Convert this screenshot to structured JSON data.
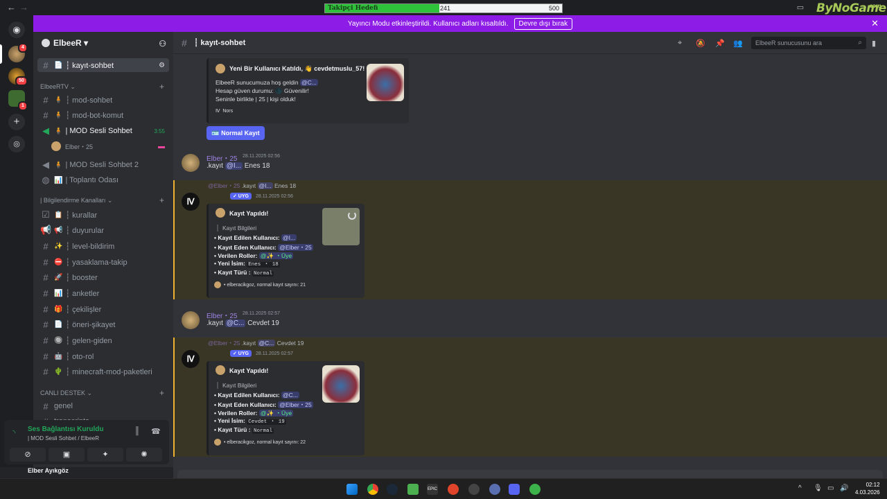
{
  "titlebar": {
    "back": "←",
    "forward": "→",
    "goal_label": "Takipçi Hedefi",
    "goal_current": "241",
    "goal_max": "500",
    "goal_progress": 0.482,
    "brand": "ByNoGame",
    "brand_suffix": ".com"
  },
  "banner": {
    "message": "Yayıncı Modu etkinleştirildi. Kullanıcı adları kısaltıldı.",
    "button": "Devre dışı bırak",
    "close": "✕"
  },
  "rail": {
    "badges": [
      "4",
      "50",
      "1"
    ]
  },
  "server": {
    "name": "ElbeeR ▾"
  },
  "channels": {
    "active": "┆ kayıt-sohbet",
    "cat1": "ElbeeRTV ⌄",
    "mod_sohbet": "┆ mod-sohbet",
    "mod_bot": "┆ mod-bot-komut",
    "mod_voice": "| MOD Sesli Sohbet",
    "mod_voice_time": "3:55",
    "voice_user": "Elber・25",
    "mod_voice2": "| MOD Sesli Sohbet 2",
    "meeting": "| Toplantı Odası",
    "cat2": "| Bilgilendirme Kanalları ⌄",
    "kurallar": "┆ kurallar",
    "duyurular": "┆ duyurular",
    "level": "┆ level-bildirim",
    "yasak": "┆ yasaklama-takip",
    "booster": "┆ booster",
    "anketler": "┆ anketler",
    "cekilis": "┆ çekilişler",
    "oneri": "┆ öneri-şikayet",
    "gelen": "┆ gelen-giden",
    "otorol": "┆ oto-rol",
    "minecraft": "┆ minecraft-mod-paketleri",
    "cat3": "CANLI DESTEK ⌄",
    "genel": "genel",
    "trans": "transcripts"
  },
  "voice_panel": {
    "status": "Ses Bağlantısı Kuruldu",
    "location": "| MOD Sesli Sohbet / ElbeeR"
  },
  "userbar": {
    "name": "Elber Ayıkgöz"
  },
  "header": {
    "channel": "┆ kayıt-sohbet",
    "search_placeholder": "ElbeeR sunucusunu ara"
  },
  "messages": {
    "welcome_title": "Yeni Bir Kullanıcı Katıldı, 👋 cevdetmuslu_57!",
    "welcome_l1": "ElbeeR sunucumuza hoş geldin",
    "welcome_l1_mention": "@C...",
    "welcome_l2": "Hesap güven durumu:",
    "welcome_l2b": "Güvenilir!",
    "welcome_l3": "Seninle birlikte | 25 | kişi olduk!",
    "welcome_footer": "Nors",
    "normal_button": "🪪 Normal Kayıt",
    "m1_name": "Elber・25",
    "m1_ts": "28.11.2025 02:56",
    "m1_cmd": ".kayıt",
    "m1_mention": "@I...",
    "m1_rest": "Enes 18",
    "r1_ref_name": "@Elber・25",
    "r1_ref_cmd": ".kayıt",
    "r1_ref_mention": "@I...",
    "r1_ref_rest": "Enes 18",
    "uyg": "✓ UYG",
    "r1_ts": "28.11.2025 02:56",
    "embed_title": "Kayıt Yapıldı!",
    "embed_info": "Kayıt Bilgileri",
    "k_edilen": "• Kayıt Edilen Kullanıcı:",
    "k_eden": "• Kayıt Eden Kullanıcı:",
    "k_roller": "• Verilen Roller:",
    "k_isim": "• Yeni İsim:",
    "k_tur": "• Kayıt Türü :",
    "r1_edilen_val": "@I...",
    "r1_eden_val": "@Elber・25",
    "roller_val": "@✨ ・Üye",
    "r1_isim_val": "Enes ・ 18",
    "tur_val": "Normal",
    "r1_footer": "• elberacikgoz, normal kayıt sayını: 21",
    "m2_name": "Elber・25",
    "m2_ts": "28.11.2025 02:57",
    "m2_cmd": ".kayıt",
    "m2_mention": "@C...",
    "m2_rest": "Cevdet 19",
    "r2_ref_name": "@Elber・25",
    "r2_ref_cmd": ".kayıt",
    "r2_ref_mention": "@C...",
    "r2_ref_rest": "Cevdet 19",
    "r2_ts": "28.11.2025 02:57",
    "r2_edilen_val": "@C...",
    "r2_eden_val": "@Elber・25",
    "r2_isim_val": "Cevdet ・ 19",
    "r2_footer": "• elberacikgoz, normal kayıt sayını: 22"
  },
  "taskbar": {
    "time": "02:12",
    "date": "4.03.2026"
  },
  "colors": {
    "accent": "#5865f2",
    "banner": "#8c1ce6",
    "online": "#23a55a"
  }
}
